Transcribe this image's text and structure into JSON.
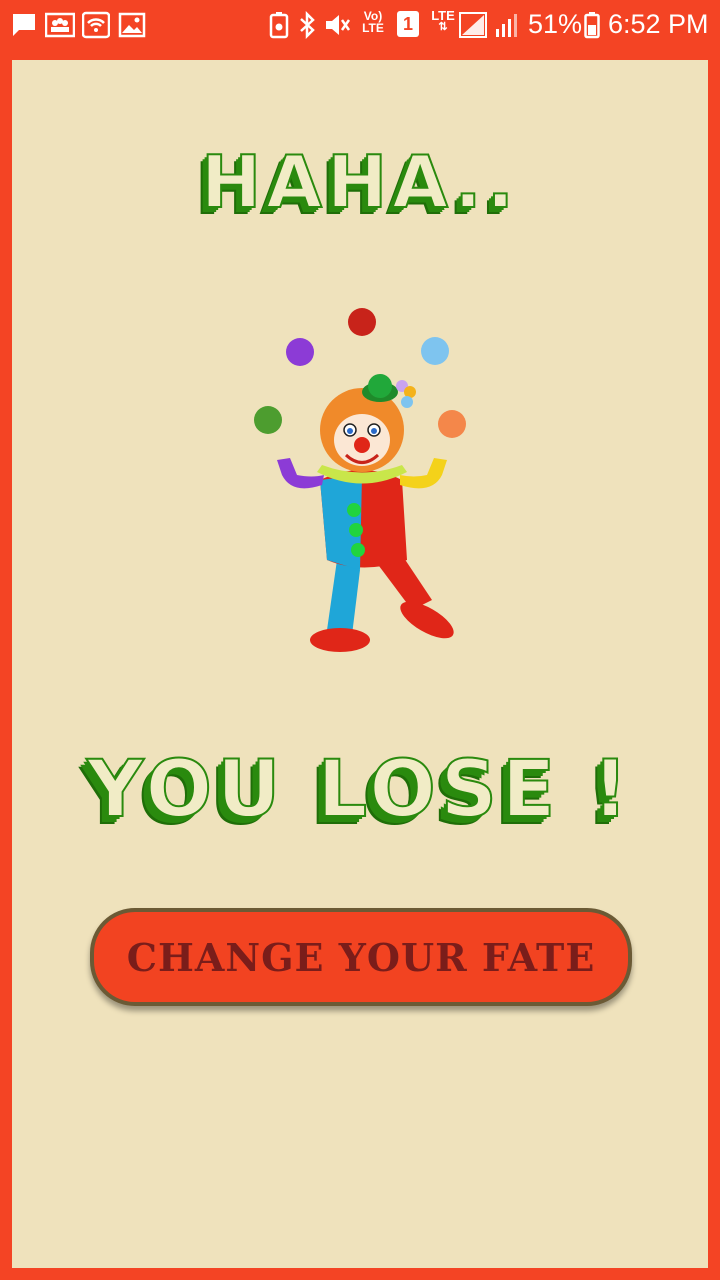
{
  "status_bar": {
    "battery_percent": "51%",
    "time": "6:52 PM",
    "volte_label_top": "Vo)",
    "volte_label_bottom": "LTE",
    "sim_slot": "1",
    "network_label": "LTE",
    "icons": [
      "message-icon",
      "contacts-icon",
      "wifi-icon",
      "image-icon",
      "battery-saver-icon",
      "bluetooth-icon",
      "mute-icon",
      "volte-icon",
      "sim-icon",
      "lte-signal-icon",
      "signal-icon",
      "battery-icon"
    ]
  },
  "screen": {
    "title_top": "HAHA..",
    "title_bottom": "YOU LOSE !",
    "button_label": "CHANGE YOUR FATE",
    "illustration": "juggling-clown-image"
  },
  "colors": {
    "frame": "#f44424",
    "panel": "#efe2bc",
    "title_green": "#2a8a0e",
    "button_fill": "#f24321",
    "button_text": "#7a1d1a"
  }
}
